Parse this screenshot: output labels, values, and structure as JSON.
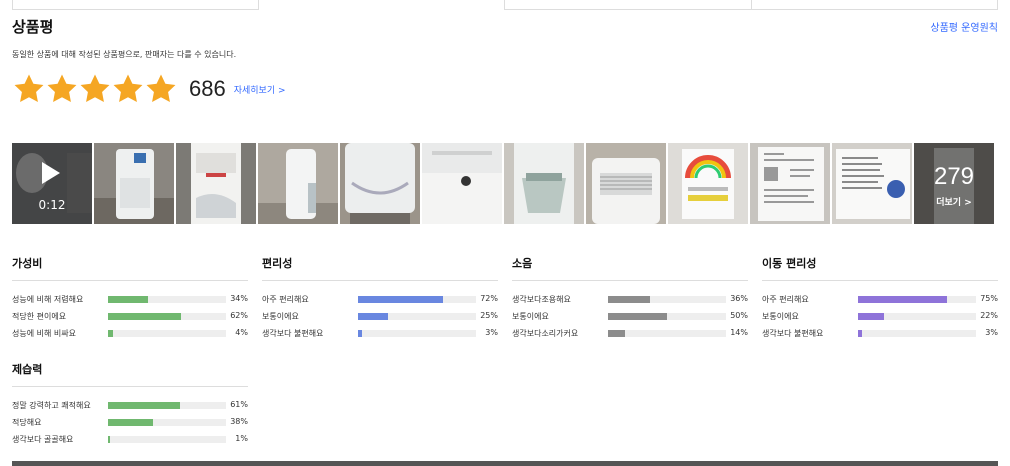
{
  "header": {
    "title": "상품평",
    "policy_link": "상품평 운영원칙",
    "description": "동일한 상품에 대해 작성된 상품평으로, 판매자는 다를 수 있습니다."
  },
  "rating": {
    "stars": 5,
    "review_count": "686",
    "details_link": "자세히보기 >"
  },
  "gallery": {
    "video_duration": "0:12",
    "more_count": "279",
    "more_label": "더보기 >",
    "icons": [
      "play-icon"
    ]
  },
  "colors": {
    "star": "#f5a623",
    "value": "#70b86f",
    "convenience": "#6987e0",
    "noise": "#8c8c8c",
    "mobility": "#8e73d9",
    "dehumid": "#70b86f",
    "link": "#346aff"
  },
  "summary": [
    {
      "title": "가성비",
      "color_key": "value",
      "rows": [
        {
          "label": "성능에 비해 저렴해요",
          "percent": "34%",
          "fraction": 0.34
        },
        {
          "label": "적당한 편이에요",
          "percent": "62%",
          "fraction": 0.62
        },
        {
          "label": "성능에 비해 비싸요",
          "percent": "4%",
          "fraction": 0.04
        }
      ]
    },
    {
      "title": "편리성",
      "color_key": "convenience",
      "rows": [
        {
          "label": "아주 편리해요",
          "percent": "72%",
          "fraction": 0.72
        },
        {
          "label": "보통이에요",
          "percent": "25%",
          "fraction": 0.25
        },
        {
          "label": "생각보다 불편해요",
          "percent": "3%",
          "fraction": 0.03
        }
      ]
    },
    {
      "title": "소음",
      "color_key": "noise",
      "rows": [
        {
          "label": "생각보다조용해요",
          "percent": "36%",
          "fraction": 0.36
        },
        {
          "label": "보통이에요",
          "percent": "50%",
          "fraction": 0.5
        },
        {
          "label": "생각보다소리가커요",
          "percent": "14%",
          "fraction": 0.14
        }
      ]
    },
    {
      "title": "이동 편리성",
      "color_key": "mobility",
      "rows": [
        {
          "label": "아주 편리해요",
          "percent": "75%",
          "fraction": 0.75
        },
        {
          "label": "보통이에요",
          "percent": "22%",
          "fraction": 0.22
        },
        {
          "label": "생각보다 불편해요",
          "percent": "3%",
          "fraction": 0.03
        }
      ]
    },
    {
      "title": "제습력",
      "color_key": "dehumid",
      "rows": [
        {
          "label": "정말 강력하고 쾌적해요",
          "percent": "61%",
          "fraction": 0.61
        },
        {
          "label": "적당해요",
          "percent": "38%",
          "fraction": 0.38
        },
        {
          "label": "생각보다 골골해요",
          "percent": "1%",
          "fraction": 0.01
        }
      ]
    }
  ]
}
